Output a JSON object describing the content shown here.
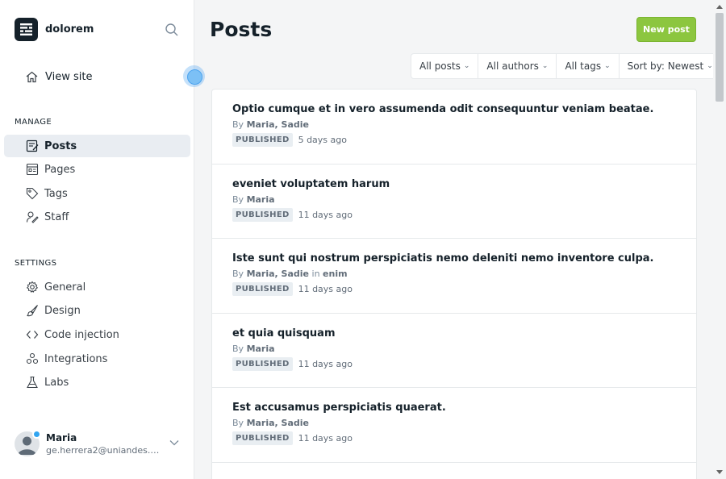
{
  "brand": {
    "name": "dolorem"
  },
  "nav": {
    "view_site": "View site",
    "manage_title": "MANAGE",
    "manage_items": [
      {
        "label": "Posts",
        "icon": "posts-icon",
        "active": true
      },
      {
        "label": "Pages",
        "icon": "pages-icon"
      },
      {
        "label": "Tags",
        "icon": "tag-icon"
      },
      {
        "label": "Staff",
        "icon": "staff-icon"
      }
    ],
    "settings_title": "SETTINGS",
    "settings_items": [
      {
        "label": "General",
        "icon": "gear-icon"
      },
      {
        "label": "Design",
        "icon": "brush-icon"
      },
      {
        "label": "Code injection",
        "icon": "code-icon"
      },
      {
        "label": "Integrations",
        "icon": "integrations-icon"
      },
      {
        "label": "Labs",
        "icon": "flask-icon"
      }
    ]
  },
  "user": {
    "name": "Maria",
    "email": "ge.herrera2@uniandes.edu.co"
  },
  "main": {
    "title": "Posts",
    "new_post": "New post"
  },
  "filters": {
    "posts": "All posts",
    "authors": "All authors",
    "tags": "All tags",
    "sort": "Sort by: Newest"
  },
  "posts": [
    {
      "title": "Optio cumque et in vero assumenda odit consequuntur veniam beatae.",
      "by": "By",
      "authors": "Maria, Sadie",
      "in": "",
      "tag": "",
      "status": "PUBLISHED",
      "time": "5 days ago"
    },
    {
      "title": "eveniet voluptatem harum",
      "by": "By",
      "authors": "Maria",
      "in": "",
      "tag": "",
      "status": "PUBLISHED",
      "time": "11 days ago"
    },
    {
      "title": "Iste sunt qui nostrum perspiciatis nemo deleniti nemo inventore culpa.",
      "by": "By",
      "authors": "Maria, Sadie",
      "in": "in",
      "tag": "enim",
      "status": "PUBLISHED",
      "time": "11 days ago"
    },
    {
      "title": "et quia quisquam",
      "by": "By",
      "authors": "Maria",
      "in": "",
      "tag": "",
      "status": "PUBLISHED",
      "time": "11 days ago"
    },
    {
      "title": "Est accusamus perspiciatis quaerat.",
      "by": "By",
      "authors": "Maria, Sadie",
      "in": "",
      "tag": "",
      "status": "PUBLISHED",
      "time": "11 days ago"
    }
  ],
  "colors": {
    "accent": "#8cc63f",
    "active_bg": "#e9edf2",
    "badge_bg": "#e9eef2"
  }
}
